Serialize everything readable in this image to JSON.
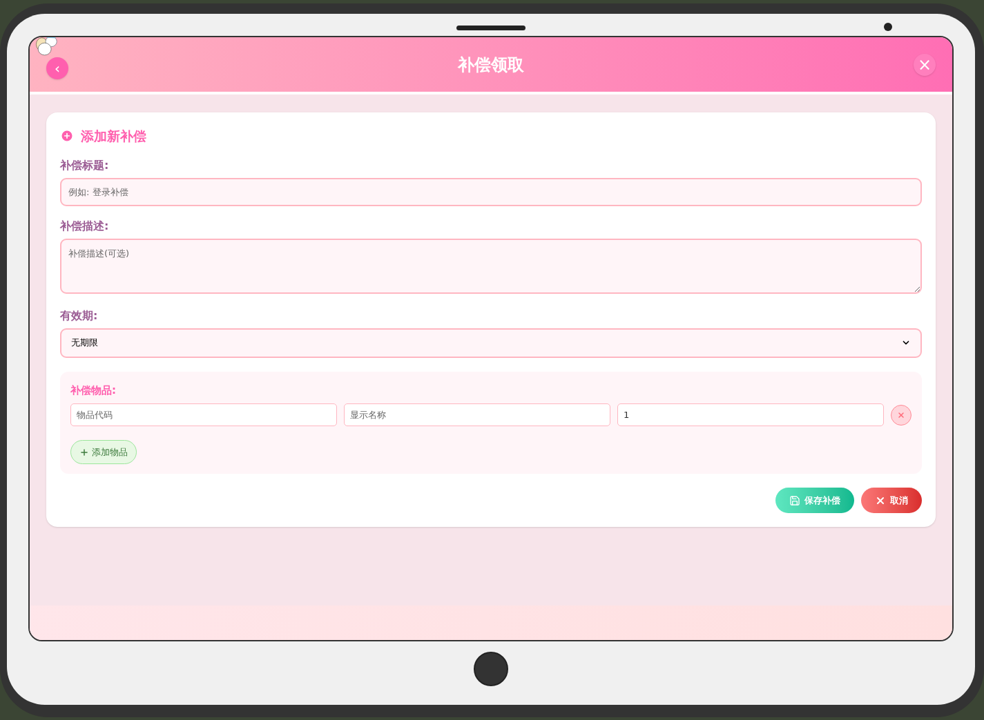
{
  "header": {
    "back_icon": "‹",
    "title": "补偿领取",
    "close": "×"
  },
  "form": {
    "heading": "添加新补偿",
    "title_field": {
      "label": "补偿标题:",
      "placeholder": "例如: 登录补偿"
    },
    "description_field": {
      "label": "补偿描述:",
      "placeholder": "补偿描述(可选)"
    },
    "validity_field": {
      "label": "有效期:",
      "value": "无期限"
    },
    "items_section": {
      "label": "补偿物品:",
      "items": [
        {
          "code_placeholder": "物品代码",
          "name_placeholder": "显示名称",
          "quantity": "1"
        }
      ],
      "add_button": "添加物品"
    },
    "buttons": [
      {
        "kind": "save",
        "label": "保存补偿"
      },
      {
        "kind": "cancel",
        "label": "取消"
      }
    ]
  }
}
